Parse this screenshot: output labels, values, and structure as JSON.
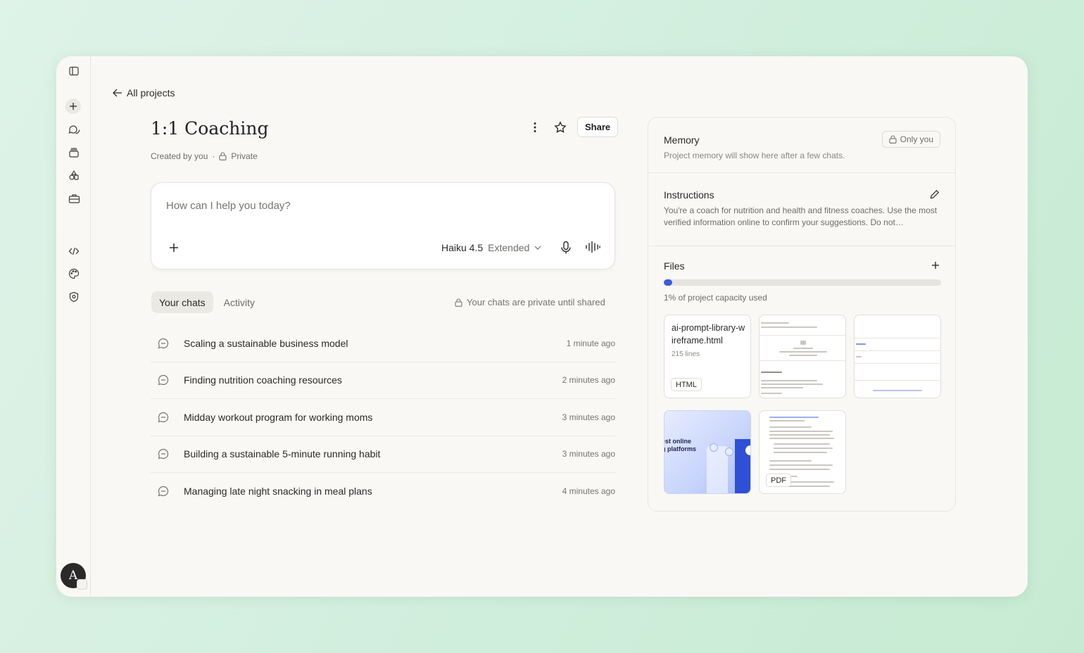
{
  "nav": {
    "back_label": "All projects"
  },
  "project": {
    "title": "1:1 Coaching",
    "created_by": "Created by you",
    "separator": "·",
    "visibility": "Private",
    "share_label": "Share"
  },
  "composer": {
    "placeholder": "How can I help you today?",
    "model_name": "Haiku 4.5",
    "model_mode": "Extended"
  },
  "tabs": [
    {
      "label": "Your chats",
      "active": true
    },
    {
      "label": "Activity",
      "active": false
    }
  ],
  "private_note": "Your chats are private until shared",
  "chats": [
    {
      "title": "Scaling a sustainable business model",
      "time": "1 minute ago"
    },
    {
      "title": "Finding nutrition coaching resources",
      "time": "2 minutes ago"
    },
    {
      "title": "Midday workout program for working moms",
      "time": "3 minutes ago"
    },
    {
      "title": "Building a sustainable 5-minute running habit",
      "time": "3 minutes ago"
    },
    {
      "title": "Managing late night snacking in meal plans",
      "time": "4 minutes ago"
    }
  ],
  "memory": {
    "title": "Memory",
    "badge": "Only you",
    "subtitle": "Project memory will show here after a few chats."
  },
  "instructions": {
    "title": "Instructions",
    "text": "You're a coach for nutrition and health and fitness coaches. Use the most verified information online to confirm your suggestions. Do not…"
  },
  "files": {
    "title": "Files",
    "capacity_label": "1% of project capacity used",
    "capacity_fraction": 0.03,
    "items": [
      {
        "name": "ai-prompt-library-wireframe.html",
        "lines": "215 lines",
        "tag": "HTML"
      },
      {
        "thumbnail": "document-preview"
      },
      {
        "thumbnail": "document-preview"
      },
      {
        "thumbnail": "image-preview",
        "caption": "est online\n platforms"
      },
      {
        "thumbnail": "document-preview",
        "tag": "PDF"
      }
    ]
  },
  "user": {
    "avatar_initial": "A"
  },
  "colors": {
    "accent": "#3b5bd8",
    "background": "#f9f8f5"
  }
}
